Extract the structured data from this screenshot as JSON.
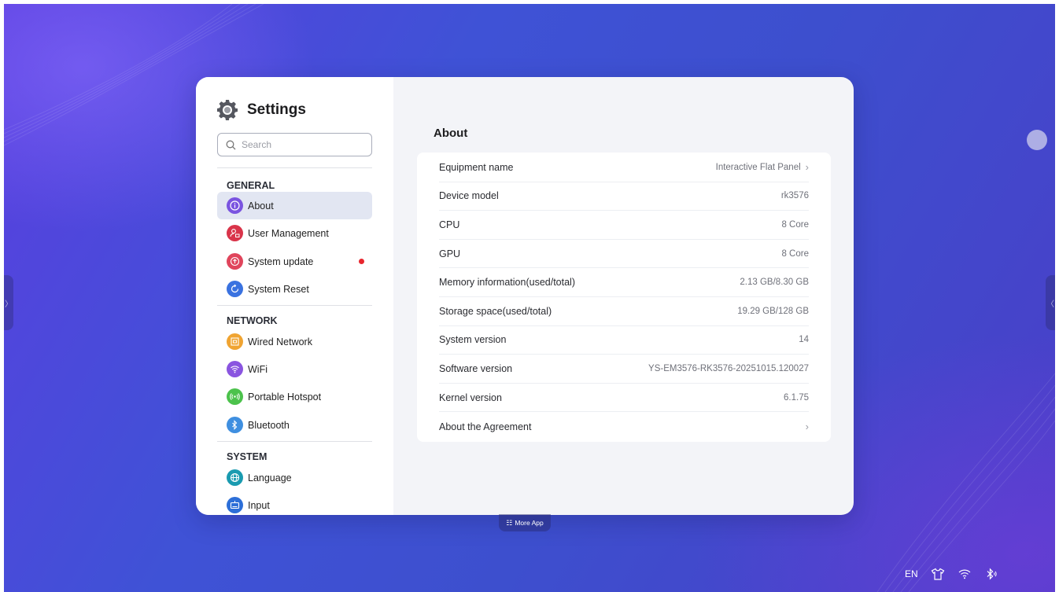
{
  "settings": {
    "title": "Settings",
    "search_placeholder": "Search"
  },
  "sidebar": {
    "sections": [
      {
        "title": "GENERAL",
        "items": [
          {
            "label": "About",
            "icon": "info-icon",
            "color": "#7a54e0",
            "active": true
          },
          {
            "label": "User Management",
            "icon": "user-lock-icon",
            "color": "#d9344a"
          },
          {
            "label": "System update",
            "icon": "update-arrow-icon",
            "color": "#e0455c",
            "badge": "red-dot"
          },
          {
            "label": "System Reset",
            "icon": "reset-icon",
            "color": "#3a72e0"
          }
        ]
      },
      {
        "title": "NETWORK",
        "items": [
          {
            "label": "Wired Network",
            "icon": "ethernet-icon",
            "color": "#f0a432"
          },
          {
            "label": "WiFi",
            "icon": "wifi-icon",
            "color": "#8a55e0"
          },
          {
            "label": "Portable Hotspot",
            "icon": "hotspot-icon",
            "color": "#4cc24c"
          },
          {
            "label": "Bluetooth",
            "icon": "bluetooth-icon",
            "color": "#3f8fe0"
          }
        ]
      },
      {
        "title": "SYSTEM",
        "items": [
          {
            "label": "Language",
            "icon": "globe-icon",
            "color": "#1a9bb0"
          },
          {
            "label": "Input",
            "icon": "keyboard-icon",
            "color": "#2d6fd8"
          }
        ]
      }
    ]
  },
  "about": {
    "title": "About",
    "rows": [
      {
        "label": "Equipment name",
        "value": "Interactive Flat Panel",
        "chevron": true
      },
      {
        "label": "Device model",
        "value": "rk3576"
      },
      {
        "label": "CPU",
        "value": "8 Core"
      },
      {
        "label": "GPU",
        "value": "8 Core"
      },
      {
        "label": "Memory information(used/total)",
        "value": "2.13 GB/8.30 GB"
      },
      {
        "label": "Storage space(used/total)",
        "value": "19.29 GB/128 GB"
      },
      {
        "label": "System version",
        "value": "14"
      },
      {
        "label": "Software version",
        "value": "YS-EM3576-RK3576-20251015.120027"
      },
      {
        "label": "Kernel version",
        "value": "6.1.75"
      },
      {
        "label": "About the Agreement",
        "value": "",
        "chevron": true
      }
    ]
  },
  "dock": {
    "more_app_label": "More App",
    "more_app_icon": "grid-icon"
  },
  "tray": {
    "language": "EN",
    "icons": [
      "shirt-icon",
      "wifi-icon",
      "bluetooth-icon"
    ]
  },
  "handles": {
    "left_glyph": "〉",
    "right_glyph": "〈"
  },
  "colors": {
    "accent_active_bg": "#e2e6f2",
    "badge_red": "#e8262e"
  }
}
